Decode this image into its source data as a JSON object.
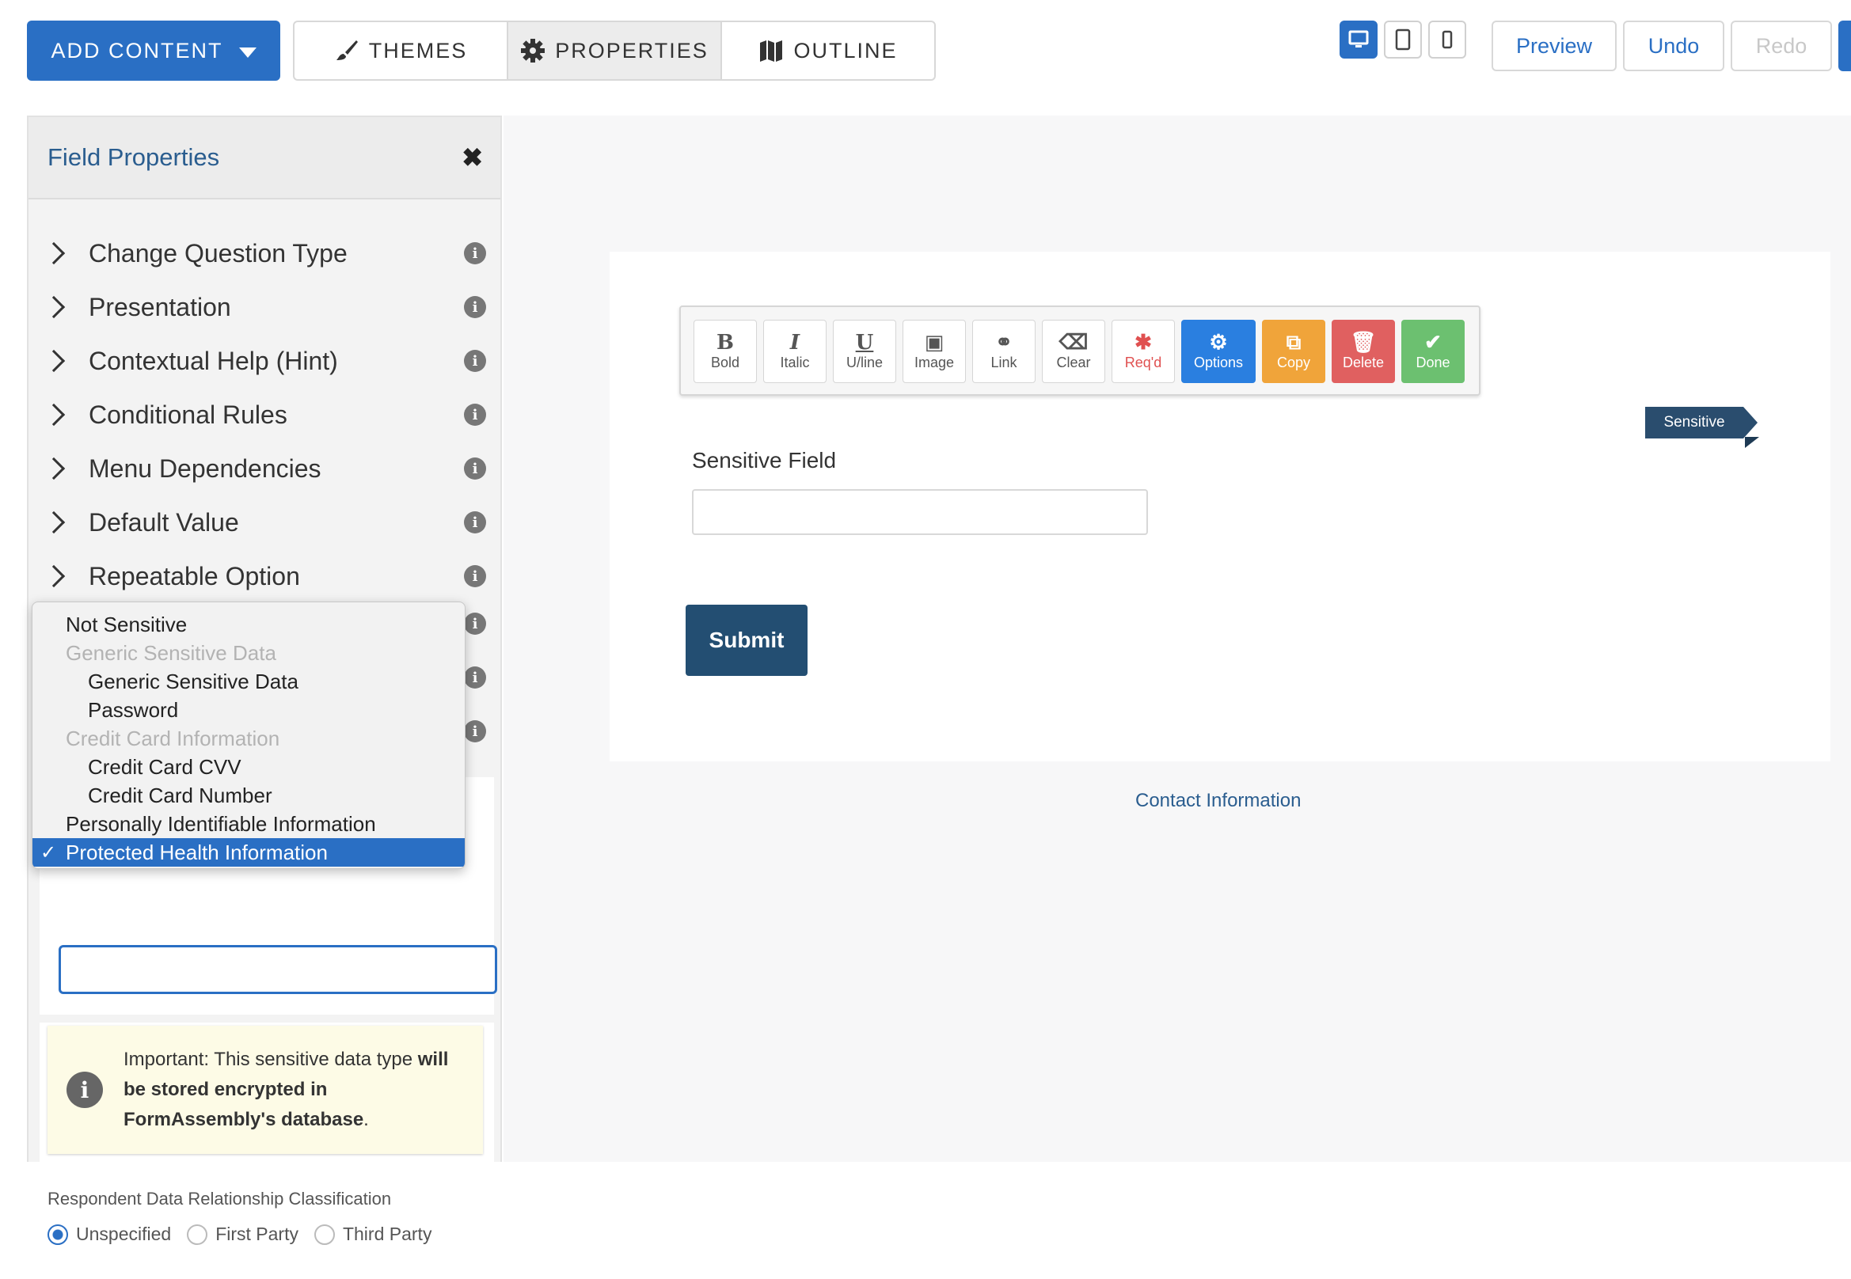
{
  "header": {
    "add_content": "ADD CONTENT",
    "tabs": [
      {
        "label": "THEMES",
        "icon": "brush-icon"
      },
      {
        "label": "PROPERTIES",
        "icon": "gear-icon"
      },
      {
        "label": "OUTLINE",
        "icon": "map-icon"
      }
    ],
    "active_tab": "PROPERTIES",
    "devices": [
      "desktop-icon",
      "tablet-icon",
      "mobile-icon"
    ],
    "preview": "Preview",
    "undo": "Undo",
    "redo": "Redo"
  },
  "sidebar": {
    "title": "Field Properties",
    "items": [
      {
        "label": "Change Question Type"
      },
      {
        "label": "Presentation"
      },
      {
        "label": "Contextual Help (Hint)"
      },
      {
        "label": "Conditional Rules"
      },
      {
        "label": "Menu Dependencies"
      },
      {
        "label": "Default Value"
      },
      {
        "label": "Repeatable Option"
      }
    ],
    "dropdown": {
      "options": [
        {
          "label": "Not Sensitive",
          "kind": "option"
        },
        {
          "label": "Generic Sensitive Data",
          "kind": "group"
        },
        {
          "label": "Generic Sensitive Data",
          "kind": "sub"
        },
        {
          "label": "Password",
          "kind": "sub"
        },
        {
          "label": "Credit Card Information",
          "kind": "group"
        },
        {
          "label": "Credit Card CVV",
          "kind": "sub"
        },
        {
          "label": "Credit Card Number",
          "kind": "sub"
        },
        {
          "label": "Personally Identifiable Information",
          "kind": "option"
        },
        {
          "label": "Protected Health Information",
          "kind": "selected"
        }
      ],
      "check": "✓"
    },
    "notice": {
      "text1": "Important: This sensitive data type ",
      "bold": "will be stored encrypted in FormAssembly's database",
      "text2": "."
    },
    "classification": {
      "title": "Respondent Data Relationship Classification",
      "options": [
        "Unspecified",
        "First Party",
        "Third Party"
      ],
      "selected": "Unspecified"
    }
  },
  "toolbar": {
    "buttons": [
      {
        "label": "Bold",
        "glyph": "B"
      },
      {
        "label": "Italic",
        "glyph": "I"
      },
      {
        "label": "U/line",
        "glyph": "U"
      },
      {
        "label": "Image",
        "glyph": "▣"
      },
      {
        "label": "Link",
        "glyph": "⚭"
      },
      {
        "label": "Clear",
        "glyph": "⌫"
      },
      {
        "label": "Req'd",
        "glyph": "✱"
      },
      {
        "label": "Options",
        "glyph": "⚙"
      },
      {
        "label": "Copy",
        "glyph": "⧉"
      },
      {
        "label": "Delete",
        "glyph": "🗑"
      },
      {
        "label": "Done",
        "glyph": "✔"
      }
    ]
  },
  "form": {
    "tag": "Sensitive",
    "field_label": "Sensitive Field",
    "field_value": "",
    "submit": "Submit",
    "footer_link": "Contact Information"
  }
}
